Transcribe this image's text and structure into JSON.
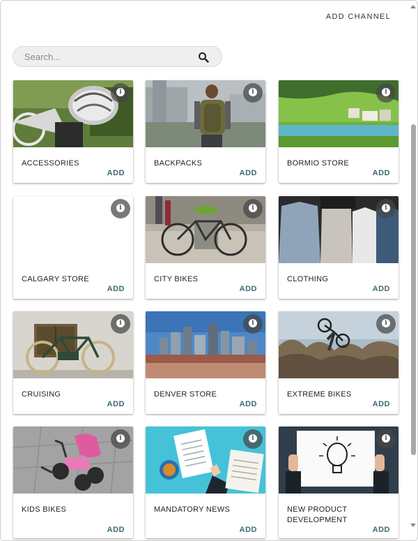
{
  "header": {
    "add_channel_label": "ADD CHANNEL"
  },
  "search": {
    "placeholder": "Search...",
    "icon": "search-icon"
  },
  "cards": [
    {
      "title": "ACCESSORIES",
      "add_label": "ADD",
      "info_glyph": "i"
    },
    {
      "title": "BACKPACKS",
      "add_label": "ADD",
      "info_glyph": "i"
    },
    {
      "title": "BORMIO STORE",
      "add_label": "ADD",
      "info_glyph": "i"
    },
    {
      "title": "CALGARY STORE",
      "add_label": "ADD",
      "info_glyph": "i"
    },
    {
      "title": "CITY BIKES",
      "add_label": "ADD",
      "info_glyph": "i"
    },
    {
      "title": "CLOTHING",
      "add_label": "ADD",
      "info_glyph": "i"
    },
    {
      "title": "CRUISING",
      "add_label": "ADD",
      "info_glyph": "i"
    },
    {
      "title": "DENVER STORE",
      "add_label": "ADD",
      "info_glyph": "i"
    },
    {
      "title": "EXTREME BIKES",
      "add_label": "ADD",
      "info_glyph": "i"
    },
    {
      "title": "KIDS BIKES",
      "add_label": "ADD",
      "info_glyph": "i"
    },
    {
      "title": "MANDATORY NEWS",
      "add_label": "ADD",
      "info_glyph": "i"
    },
    {
      "title": "NEW PRODUCT DEVELOPMENT",
      "add_label": "ADD",
      "info_glyph": "i"
    }
  ],
  "colors": {
    "accent": "#3c6a72",
    "search_bg": "#efefef"
  }
}
